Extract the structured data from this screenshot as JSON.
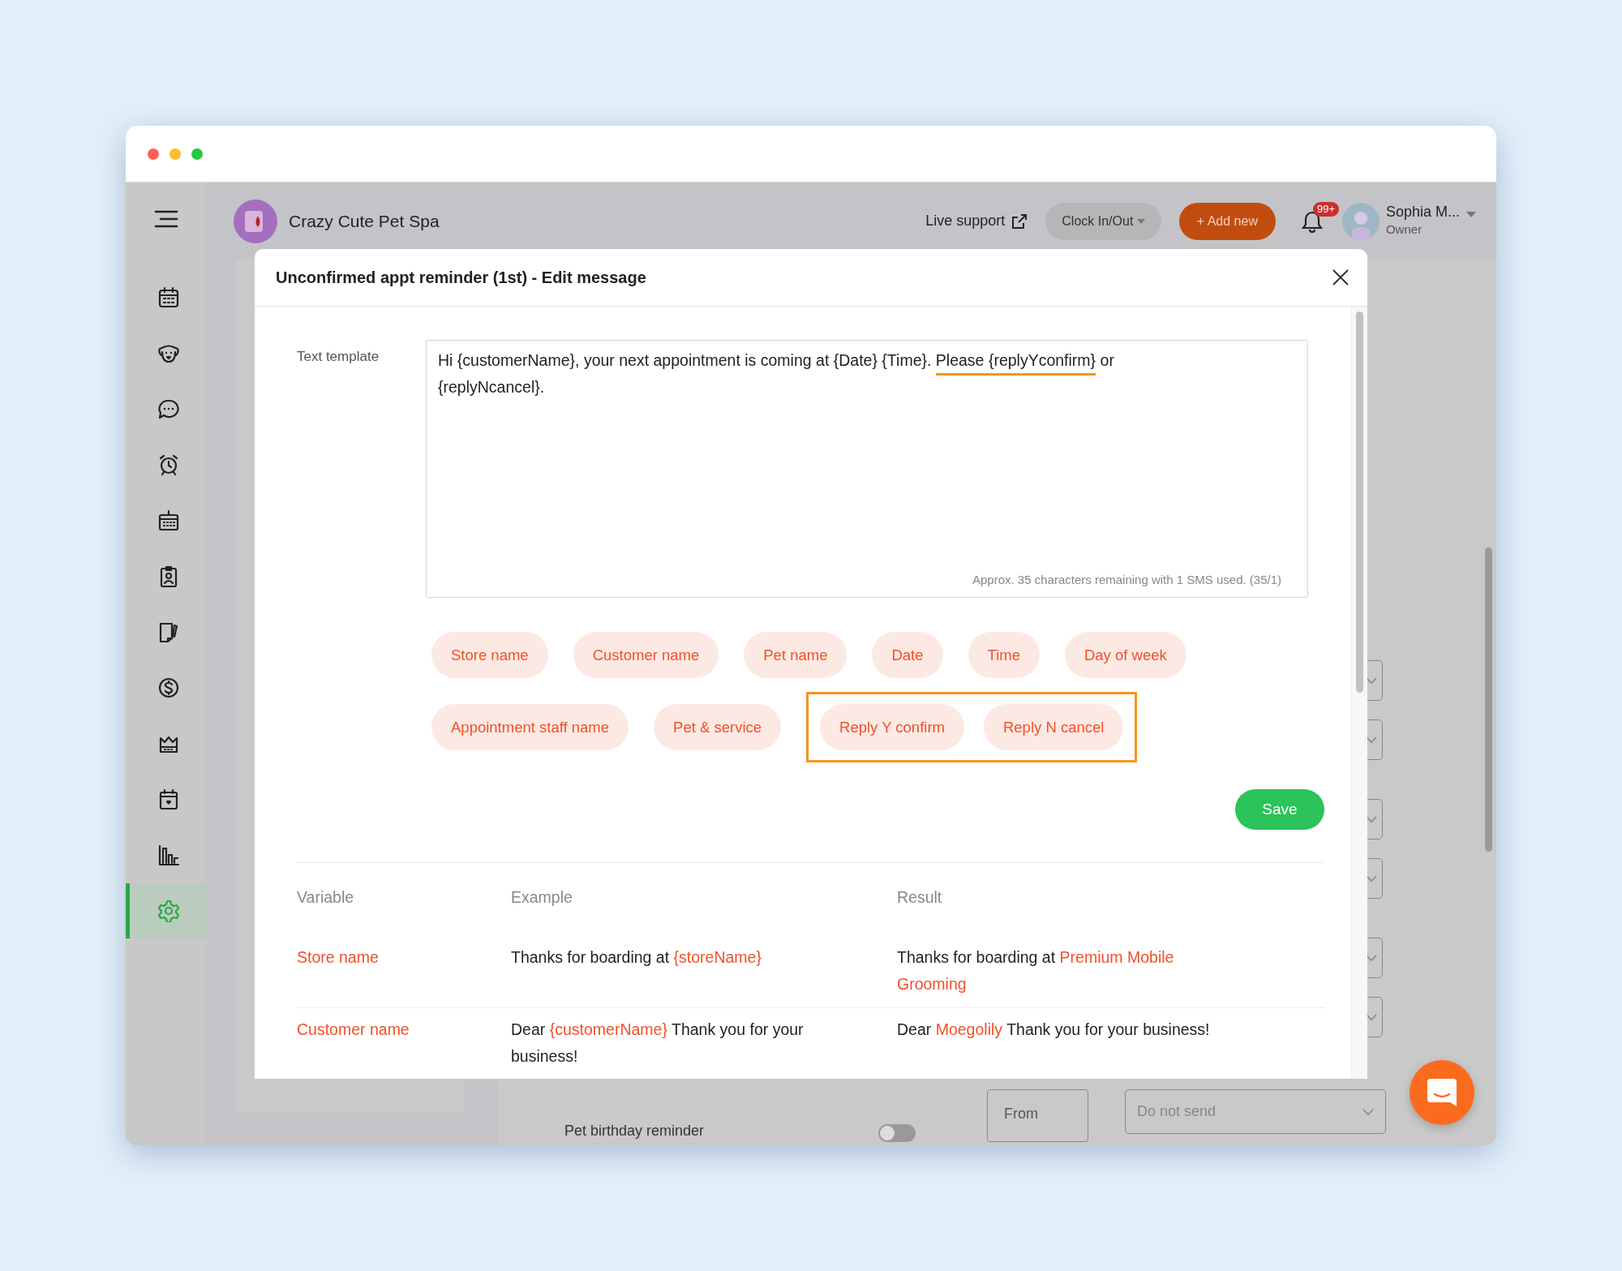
{
  "sidebar": {
    "items": [
      {
        "kind": "calendar",
        "selected": false
      },
      {
        "kind": "dog",
        "selected": false
      },
      {
        "kind": "chat",
        "selected": false
      },
      {
        "kind": "alarm",
        "selected": false
      },
      {
        "kind": "schedule",
        "selected": false
      },
      {
        "kind": "badge",
        "selected": false
      },
      {
        "kind": "note",
        "selected": false
      },
      {
        "kind": "dollar",
        "selected": false
      },
      {
        "kind": "crown",
        "selected": false
      },
      {
        "kind": "heart-calendar",
        "selected": false
      },
      {
        "kind": "chart",
        "selected": false
      },
      {
        "kind": "gear",
        "selected": true
      }
    ]
  },
  "header": {
    "store_name": "Crazy Cute Pet Spa",
    "live_support": "Live support",
    "clock_button": "Clock In/Out",
    "add_button": "+ Add new",
    "notification_count": "99+",
    "user": {
      "name": "Sophia M...",
      "role": "Owner"
    }
  },
  "modal": {
    "title": "Unconfirmed appt reminder (1st) - Edit message",
    "template_label": "Text template",
    "template": [
      {
        "text": "Hi {customerName}, your next appointment is coming at {Date} {Time}. ",
        "kind": "plain"
      },
      {
        "text": "Please {replyYconfirm}",
        "kind": "underlined"
      },
      {
        "text": " or {replyNcancel}.",
        "kind": "plain"
      }
    ],
    "counter": "Approx. 35 characters remaining with 1 SMS used. (35/1)",
    "chip_rows": [
      [
        {
          "kind": "chip",
          "label": "Store name"
        },
        {
          "kind": "chip",
          "label": "Customer name"
        },
        {
          "kind": "chip",
          "label": "Pet name"
        },
        {
          "kind": "chip",
          "label": "Date"
        },
        {
          "kind": "chip",
          "label": "Time"
        },
        {
          "kind": "chip",
          "label": "Day of week"
        }
      ],
      [
        {
          "kind": "chip",
          "label": "Appointment staff name"
        },
        {
          "kind": "chip",
          "label": "Pet & service"
        },
        {
          "kind": "frame",
          "chips": [
            {
              "label": "Reply Y confirm"
            },
            {
              "label": "Reply N cancel"
            }
          ]
        }
      ]
    ],
    "save_button": "Save",
    "table": {
      "columns": [
        "Variable",
        "Example",
        "Result"
      ],
      "rows": [
        {
          "variable": "Store name",
          "example": [
            {
              "text": "Thanks for boarding at ",
              "accent": false
            },
            {
              "text": "{storeName}",
              "accent": true
            }
          ],
          "result": [
            {
              "text": "Thanks for boarding at ",
              "accent": false
            },
            {
              "text": "Premium Mobile Grooming",
              "accent": true
            }
          ]
        },
        {
          "variable": "Customer name",
          "example": [
            {
              "text": "Dear ",
              "accent": false
            },
            {
              "text": "{customerName}",
              "accent": true
            },
            {
              "text": " Thank you for your business!",
              "accent": false
            }
          ],
          "result": [
            {
              "text": "Dear ",
              "accent": false
            },
            {
              "text": "Moegolily",
              "accent": true
            },
            {
              "text": " Thank you for your business!",
              "accent": false
            }
          ]
        }
      ]
    }
  },
  "background": {
    "reminder_label": "Pet birthday reminder",
    "toggle": {
      "on": false
    },
    "from_label": "From",
    "send_select": "Do not send"
  }
}
